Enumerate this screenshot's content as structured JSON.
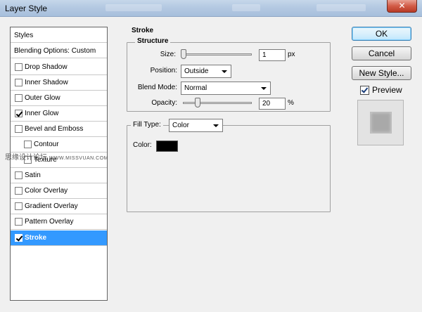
{
  "window": {
    "title": "Layer Style",
    "close_glyph": "✕"
  },
  "styles": {
    "header": "Styles",
    "blending": "Blending Options: Custom",
    "items": [
      {
        "label": "Drop Shadow",
        "checked": false
      },
      {
        "label": "Inner Shadow",
        "checked": false
      },
      {
        "label": "Outer Glow",
        "checked": false
      },
      {
        "label": "Inner Glow",
        "checked": true
      },
      {
        "label": "Bevel and Emboss",
        "checked": false
      },
      {
        "label": "Contour",
        "checked": false
      },
      {
        "label": "Texture",
        "checked": false
      },
      {
        "label": "Satin",
        "checked": false
      },
      {
        "label": "Color Overlay",
        "checked": false
      },
      {
        "label": "Gradient Overlay",
        "checked": false
      },
      {
        "label": "Pattern Overlay",
        "checked": false
      },
      {
        "label": "Stroke",
        "checked": true,
        "selected": true
      }
    ]
  },
  "watermark": {
    "cn": "思缘设计论坛",
    "url": "WWW.MISSVUAN.COM"
  },
  "stroke": {
    "title": "Stroke",
    "structure_title": "Structure",
    "size_label": "Size:",
    "size_value": "1",
    "size_unit": "px",
    "position_label": "Position:",
    "position_value": "Outside",
    "blend_mode_label": "Blend Mode:",
    "blend_mode_value": "Normal",
    "opacity_label": "Opacity:",
    "opacity_value": "20",
    "opacity_unit": "%",
    "fill_type_label": "Fill Type:",
    "fill_type_value": "Color",
    "color_label": "Color:",
    "color_hex": "#000000"
  },
  "buttons": {
    "ok": "OK",
    "cancel": "Cancel",
    "new_style": "New Style..."
  },
  "preview": {
    "label": "Preview",
    "checked": true
  }
}
